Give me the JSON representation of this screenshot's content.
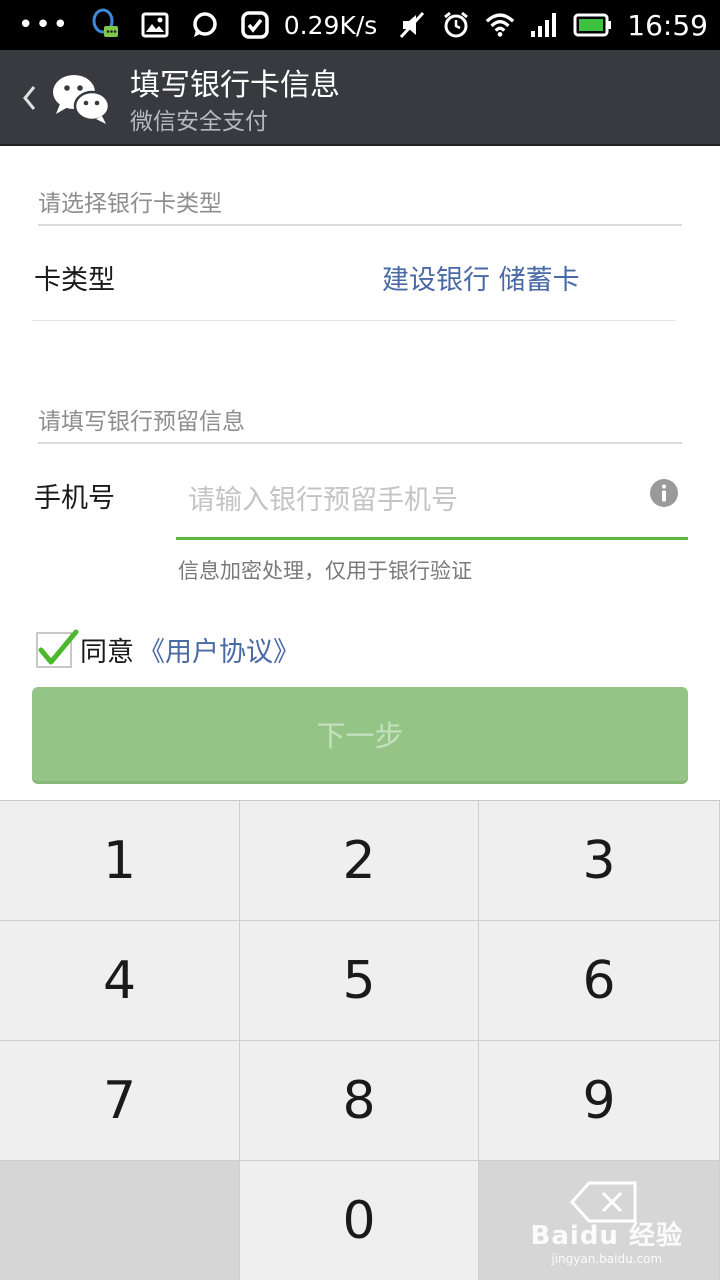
{
  "status_bar": {
    "dots": "•••",
    "speed": "0.29K/s",
    "time": "16:59",
    "icons": [
      "qq-icon",
      "image-icon",
      "chat-bubble-icon",
      "check-app-icon",
      "mute-icon",
      "alarm-icon",
      "wifi-icon",
      "signal-icon",
      "battery-icon"
    ]
  },
  "header": {
    "title": "填写银行卡信息",
    "subtitle": "微信安全支付"
  },
  "card_section": {
    "label": "请选择银行卡类型",
    "type_label": "卡类型",
    "type_value": "建设银行 储蓄卡"
  },
  "phone_section": {
    "label": "请填写银行预留信息",
    "phone_label": "手机号",
    "phone_value": "",
    "phone_placeholder": "请输入银行预留手机号",
    "hint": "信息加密处理，仅用于银行验证"
  },
  "agreement": {
    "checked": true,
    "text": "同意",
    "link": "《用户协议》"
  },
  "next_button": {
    "label": "下一步"
  },
  "keypad": {
    "keys": [
      "1",
      "2",
      "3",
      "4",
      "5",
      "6",
      "7",
      "8",
      "9",
      "0"
    ]
  },
  "watermark": {
    "main": "Baidu 经验",
    "sub": "jingyan.baidu.com"
  },
  "colors": {
    "titlebar": "#393a3f",
    "accent_green": "#5db83e",
    "button_disabled": "#94c587",
    "link_blue": "#4a6aa5"
  }
}
